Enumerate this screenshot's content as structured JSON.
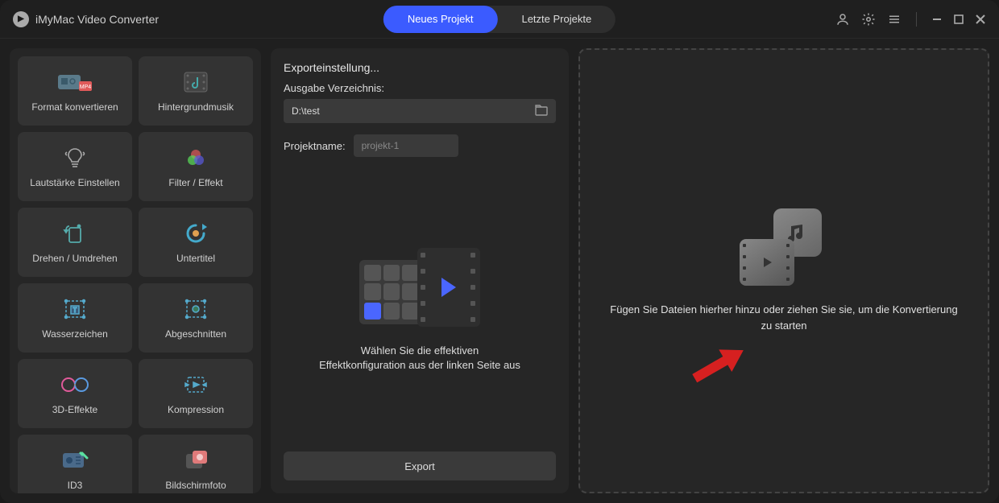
{
  "app": {
    "title": "iMyMac Video Converter"
  },
  "tabs": {
    "newProject": "Neues Projekt",
    "recentProjects": "Letzte Projekte"
  },
  "sidebar": {
    "items": [
      {
        "label": "Format konvertieren",
        "icon": "format-convert-icon"
      },
      {
        "label": "Hintergrundmusik",
        "icon": "background-music-icon"
      },
      {
        "label": "Lautstärke Einstellen",
        "icon": "volume-icon"
      },
      {
        "label": "Filter / Effekt",
        "icon": "filter-effect-icon"
      },
      {
        "label": "Drehen / Umdrehen",
        "icon": "rotate-flip-icon"
      },
      {
        "label": "Untertitel",
        "icon": "subtitle-icon"
      },
      {
        "label": "Wasserzeichen",
        "icon": "watermark-icon"
      },
      {
        "label": "Abgeschnitten",
        "icon": "crop-icon"
      },
      {
        "label": "3D-Effekte",
        "icon": "3d-effects-icon"
      },
      {
        "label": "Kompression",
        "icon": "compression-icon"
      },
      {
        "label": "ID3",
        "icon": "id3-icon"
      },
      {
        "label": "Bildschirmfoto",
        "icon": "screenshot-icon"
      }
    ]
  },
  "center": {
    "heading": "Exporteinstellung...",
    "outputDirLabel": "Ausgabe Verzeichnis:",
    "outputDirValue": "D:\\test",
    "projectNameLabel": "Projektname:",
    "projectNamePlaceholder": "projekt-1",
    "hintLine1": "Wählen Sie die effektiven",
    "hintLine2": "Effektkonfiguration aus der linken Seite aus",
    "exportLabel": "Export"
  },
  "drop": {
    "text": "Fügen Sie Dateien hierher hinzu oder ziehen Sie sie, um die Konvertierung zu starten"
  }
}
